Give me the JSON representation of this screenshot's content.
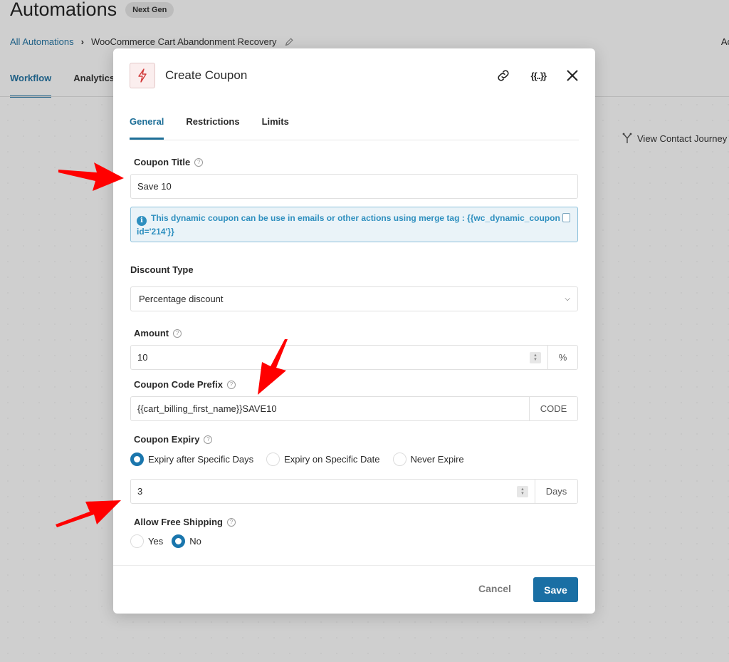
{
  "page": {
    "title": "Automations",
    "badge": "Next Gen",
    "breadcrumb": {
      "root": "All Automations",
      "current": "WooCommerce Cart Abandonment Recovery"
    },
    "top_right_text": "Ac",
    "tabs": [
      {
        "label": "Workflow",
        "active": true
      },
      {
        "label": "Analytics",
        "active": false
      }
    ],
    "journey_button": "View Contact Journey"
  },
  "modal": {
    "title": "Create Coupon",
    "header_icons": [
      "link-icon",
      "merge-tags-icon",
      "close-icon"
    ],
    "merge_tags_glyph": "{{..}}",
    "tabs": [
      {
        "label": "General",
        "active": true
      },
      {
        "label": "Restrictions",
        "active": false
      },
      {
        "label": "Limits",
        "active": false
      }
    ],
    "coupon_title": {
      "label": "Coupon Title",
      "value": "Save 10"
    },
    "notice": {
      "text": "This dynamic coupon can be use in emails or other actions using merge tag : {{wc_dynamic_coupon id='214'}}"
    },
    "discount_type": {
      "label": "Discount Type",
      "value": "Percentage discount"
    },
    "amount": {
      "label": "Amount",
      "value": "10",
      "suffix": "%"
    },
    "coupon_code_prefix": {
      "label": "Coupon Code Prefix",
      "value": "{{cart_billing_first_name}}SAVE10",
      "suffix": "CODE"
    },
    "coupon_expiry": {
      "label": "Coupon Expiry",
      "options": [
        {
          "label": "Expiry after Specific Days",
          "checked": true
        },
        {
          "label": "Expiry on Specific Date",
          "checked": false
        },
        {
          "label": "Never Expire",
          "checked": false
        }
      ],
      "days_value": "3",
      "days_suffix": "Days"
    },
    "free_shipping": {
      "label": "Allow Free Shipping",
      "options": [
        {
          "label": "Yes",
          "checked": false
        },
        {
          "label": "No",
          "checked": true
        }
      ]
    },
    "footer": {
      "cancel": "Cancel",
      "save": "Save"
    }
  },
  "colors": {
    "accent": "#1a6fa4",
    "annotation_arrow": "#ff0000",
    "notice_text": "#2e8fbf"
  }
}
